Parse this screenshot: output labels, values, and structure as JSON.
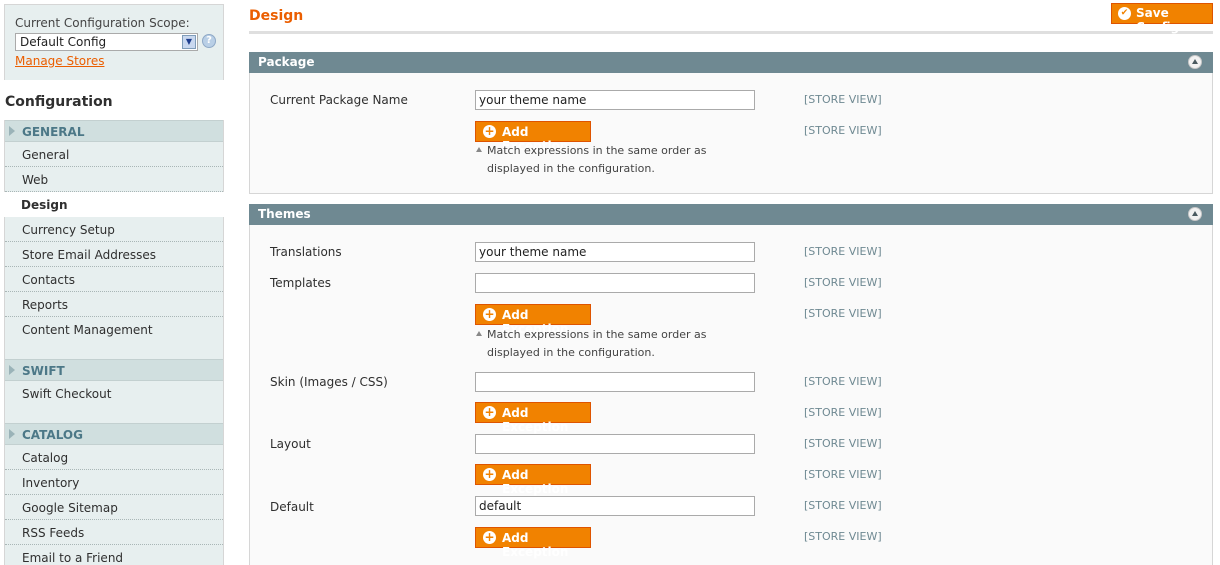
{
  "sidebar": {
    "scope_label": "Current Configuration Scope:",
    "scope_value": "Default Config",
    "manage_stores": "Manage Stores",
    "title": "Configuration",
    "groups": [
      {
        "name": "GENERAL",
        "items": [
          "General",
          "Web",
          "Design",
          "Currency Setup",
          "Store Email Addresses",
          "Contacts",
          "Reports",
          "Content Management"
        ],
        "active": "Design"
      },
      {
        "name": "SWIFT",
        "items": [
          "Swift Checkout"
        ]
      },
      {
        "name": "CATALOG",
        "items": [
          "Catalog",
          "Inventory",
          "Google Sitemap",
          "RSS Feeds",
          "Email to a Friend"
        ]
      }
    ]
  },
  "header": {
    "title": "Design",
    "save_label": "Save Config"
  },
  "package": {
    "title": "Package",
    "current_package_label": "Current Package Name",
    "current_package_value": "your theme name",
    "add_exception": "Add Exception",
    "note": "Match expressions in the same order as displayed in the configuration.",
    "scope": "[STORE VIEW]"
  },
  "themes": {
    "title": "Themes",
    "translations_label": "Translations",
    "translations_value": "your theme name",
    "templates_label": "Templates",
    "templates_value": "",
    "skin_label": "Skin (Images / CSS)",
    "skin_value": "",
    "layout_label": "Layout",
    "layout_value": "",
    "default_label": "Default",
    "default_value": "default",
    "add_exception": "Add Exception",
    "note": "Match expressions in the same order as displayed in the configuration.",
    "scope": "[STORE VIEW]"
  },
  "colors": {
    "accent": "#eb5e00",
    "button": "#f18200",
    "section_header": "#6f8992"
  }
}
